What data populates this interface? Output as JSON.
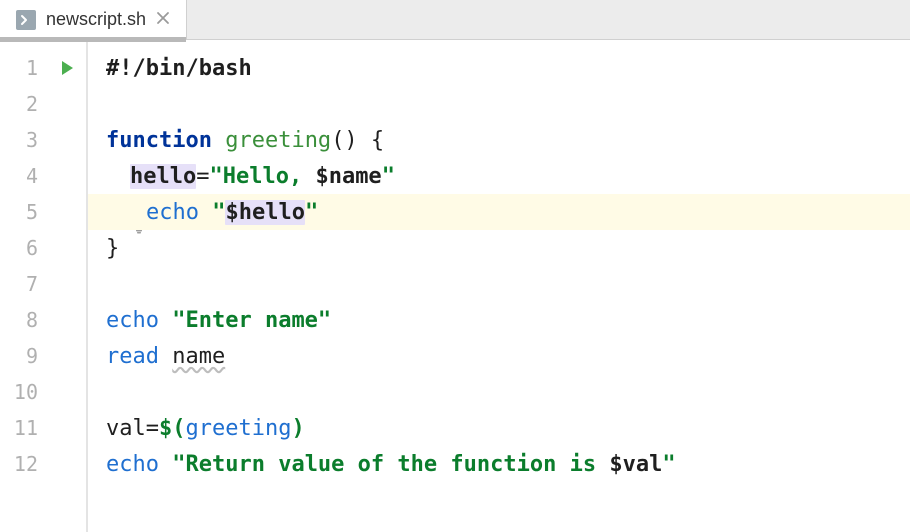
{
  "tab": {
    "filename": "newscript.sh",
    "icon": "terminal-file-icon"
  },
  "gutter": {
    "numbers": [
      "1",
      "2",
      "3",
      "4",
      "5",
      "6",
      "7",
      "8",
      "9",
      "10",
      "11",
      "12"
    ],
    "run_marker_line": 1,
    "highlighted_line": 5,
    "intention_bulb_line": 4
  },
  "code": {
    "line1": {
      "shebang": "#!/bin/bash"
    },
    "line3": {
      "kw": "function",
      "fn": "greeting",
      "rest": "() {"
    },
    "line4": {
      "varname": "hello",
      "eq": "=",
      "q1": "\"",
      "str1": "Hello, ",
      "varref": "$name",
      "q2": "\""
    },
    "line5": {
      "cmd": "echo",
      "q1": "\"",
      "varref": "$hello",
      "q2": "\""
    },
    "line6": {
      "brace": "}"
    },
    "line8": {
      "cmd": "echo",
      "str": "\"Enter name\""
    },
    "line9": {
      "cmd": "read",
      "arg": "name"
    },
    "line11": {
      "lhs": "val",
      "eq": "=",
      "dollar": "$(",
      "call": "greeting",
      "close": ")"
    },
    "line12": {
      "cmd": "echo",
      "q1": "\"",
      "str1": "Return value of the function is ",
      "varref": "$val",
      "q2": "\""
    }
  }
}
